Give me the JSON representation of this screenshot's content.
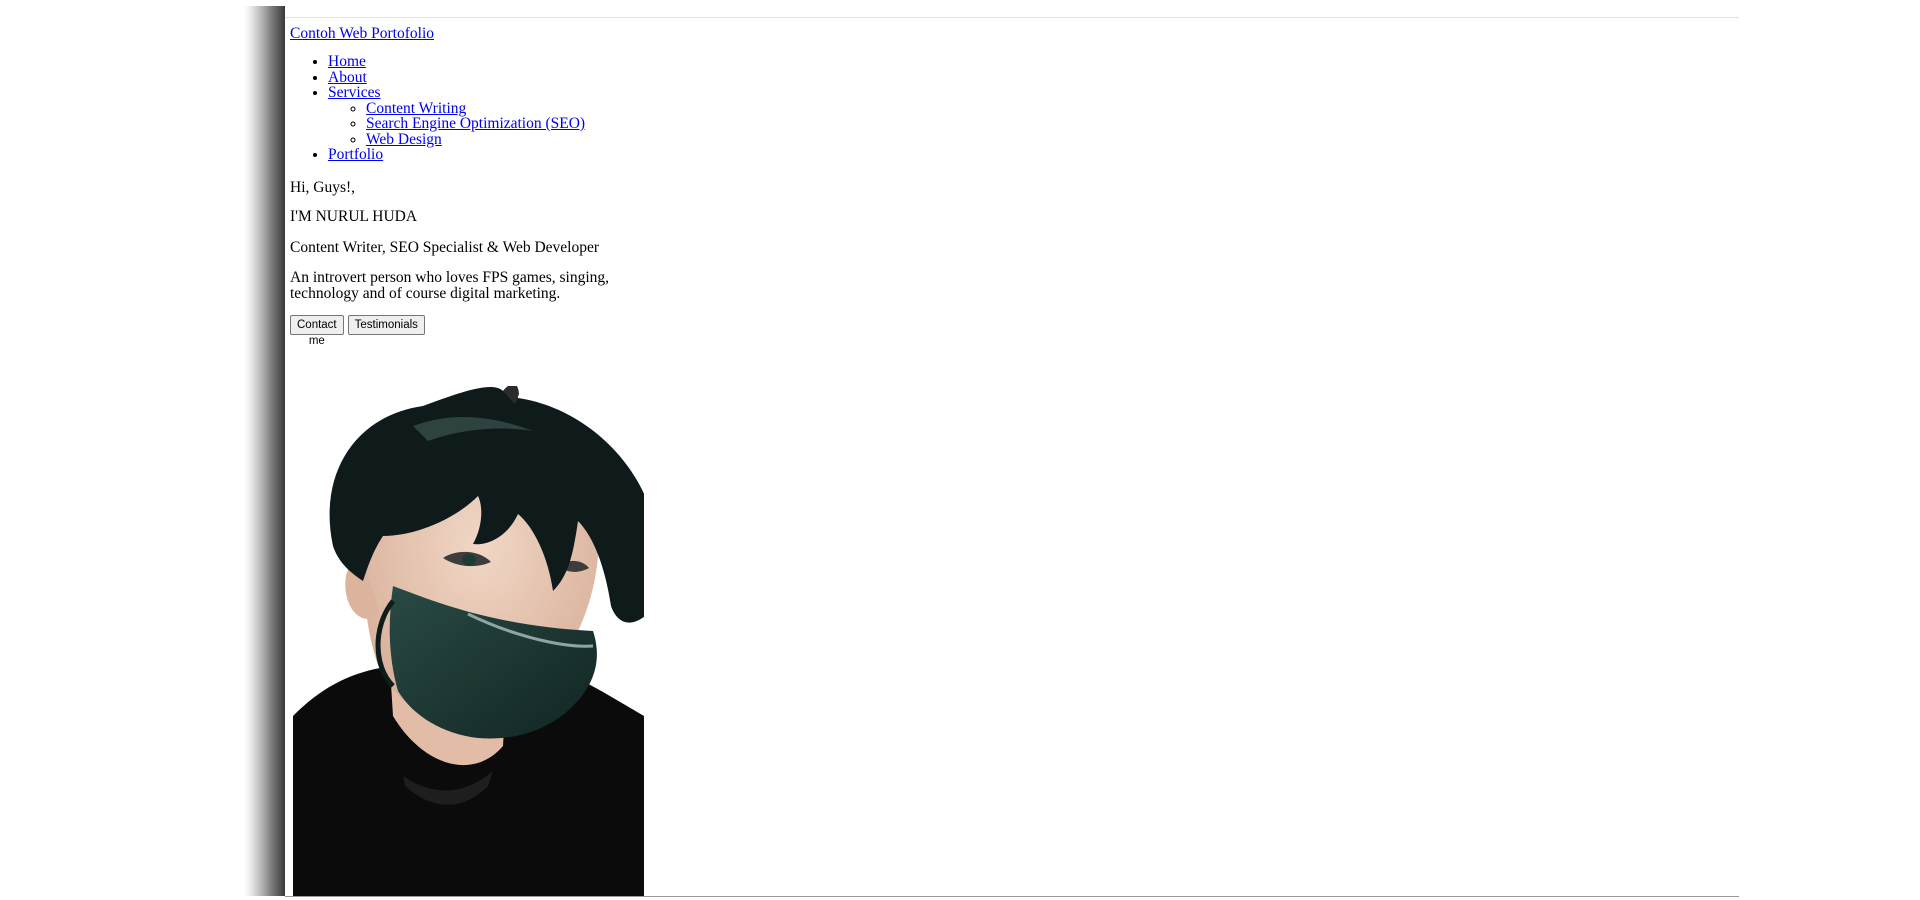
{
  "site": {
    "brand_link": "Contoh Web Portofolio"
  },
  "nav": {
    "items": [
      {
        "label": "Home"
      },
      {
        "label": "About"
      },
      {
        "label": "Services"
      },
      {
        "label": "Portfolio"
      }
    ],
    "services_submenu": [
      {
        "label": "Content Writing"
      },
      {
        "label": "Search Engine Optimization (SEO)"
      },
      {
        "label": "Web Design"
      }
    ]
  },
  "hero": {
    "greeting": "Hi, Guys!,",
    "name": "I'M NURUL HUDA",
    "role": "Content Writer, SEO Specialist & Web Developer",
    "about": "An introvert person who loves FPS games, singing, technology and of course digital marketing.",
    "contact_button": "Contact me",
    "testimonials_button": "Testimonials",
    "portrait_image": "portrait-photo-masked-person"
  },
  "colors": {
    "link": "#0000ee",
    "text": "#000000",
    "background": "#ffffff"
  }
}
